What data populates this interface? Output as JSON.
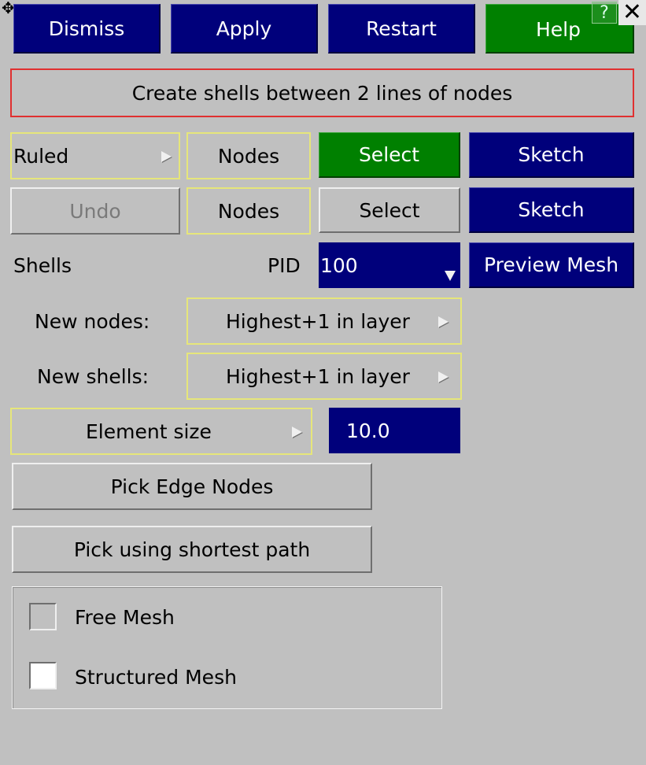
{
  "toolbar": {
    "dismiss_label": "Dismiss",
    "apply_label": "Apply",
    "restart_label": "Restart",
    "help_label": "Help",
    "help_question": "?",
    "close_glyph": "✕",
    "move_glyph": "✥"
  },
  "title": "Create shells between 2 lines of nodes",
  "row1": {
    "method": "Ruled",
    "nodes": "Nodes",
    "select": "Select",
    "sketch": "Sketch"
  },
  "row2": {
    "undo": "Undo",
    "nodes": "Nodes",
    "select": "Select",
    "sketch": "Sketch"
  },
  "shells_row": {
    "shells_label": "Shells",
    "pid_label": "PID",
    "pid_value": "100",
    "preview_label": "Preview Mesh"
  },
  "new_nodes": {
    "label": "New nodes:",
    "value": "Highest+1 in layer"
  },
  "new_shells": {
    "label": "New shells:",
    "value": "Highest+1 in layer"
  },
  "element_size": {
    "label": "Element size",
    "value": "10.0"
  },
  "pick_edge_label": "Pick Edge Nodes",
  "pick_shortest_label": "Pick using shortest path",
  "mesh_options": {
    "free_label": "Free Mesh",
    "structured_label": "Structured Mesh"
  },
  "colors": {
    "navy": "#00007b",
    "green": "#008000",
    "panel": "#c0c0c0",
    "title_border": "#e03030",
    "option_border": "#e6e67a"
  }
}
